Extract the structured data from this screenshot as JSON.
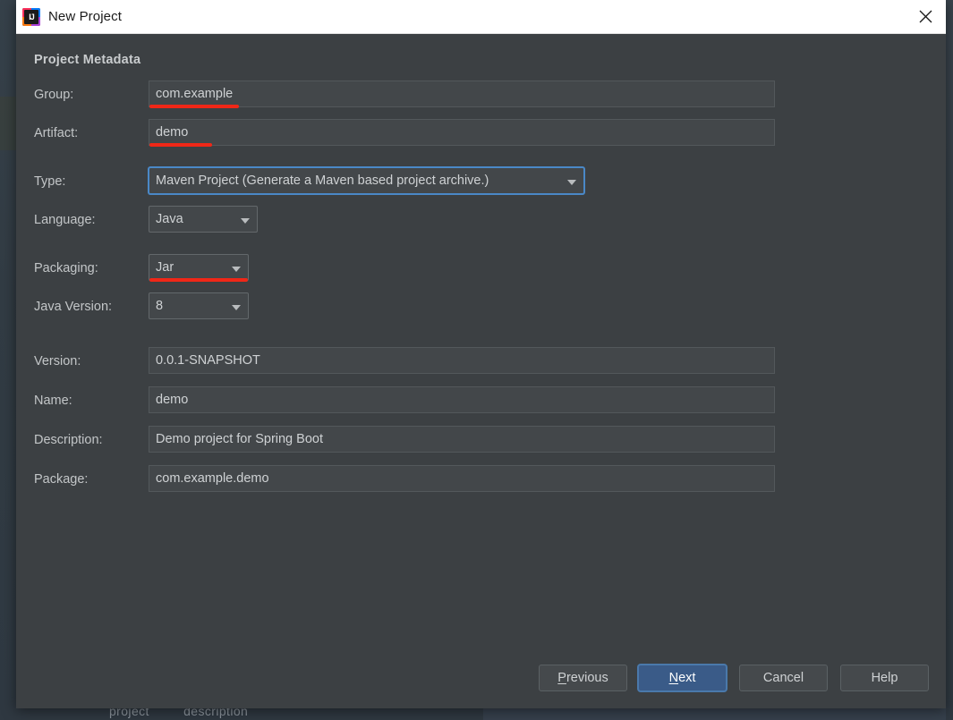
{
  "window": {
    "title": "New Project",
    "app_icon": "intellij-idea-icon",
    "close_icon": "close-icon"
  },
  "backdrop": {
    "words": [
      "project",
      "description"
    ]
  },
  "dialog": {
    "section_title": "Project Metadata",
    "fields": [
      {
        "label": "Group:",
        "value": "com.example",
        "kind": "text",
        "annotated": true,
        "width": "wide"
      },
      {
        "label": "Artifact:",
        "value": "demo",
        "kind": "text",
        "annotated": true,
        "width": "wide"
      },
      {
        "label": "Type:",
        "value": "Maven Project (Generate a Maven based project archive.)",
        "kind": "combo",
        "annotated": false,
        "focused": true
      },
      {
        "label": "Language:",
        "value": "Java",
        "kind": "combo",
        "annotated": false
      },
      {
        "label": "Packaging:",
        "value": "Jar",
        "kind": "combo",
        "annotated": true
      },
      {
        "label": "Java Version:",
        "value": "8",
        "kind": "combo",
        "annotated": false
      },
      {
        "label": "Version:",
        "value": "0.0.1-SNAPSHOT",
        "kind": "text",
        "annotated": false,
        "width": "wide"
      },
      {
        "label": "Name:",
        "value": "demo",
        "kind": "text",
        "annotated": false,
        "width": "wide"
      },
      {
        "label": "Description:",
        "value": "Demo project for Spring Boot",
        "kind": "text",
        "annotated": false,
        "width": "wide"
      },
      {
        "label": "Package:",
        "value": "com.example.demo",
        "kind": "text",
        "annotated": false,
        "width": "wide"
      }
    ],
    "buttons": {
      "previous": {
        "label": "Previous",
        "mnemonic": "P"
      },
      "next": {
        "label": "Next",
        "mnemonic": "N",
        "primary": true
      },
      "cancel": {
        "label": "Cancel"
      },
      "help": {
        "label": "Help"
      }
    }
  },
  "colors": {
    "dialog_bg": "#3c4043",
    "field_bg": "#43474a",
    "accent_focus": "#4a88c7",
    "primary_button": "#3a5b88",
    "annotation_red": "#f02717",
    "titlebar_bg": "#ffffff"
  }
}
